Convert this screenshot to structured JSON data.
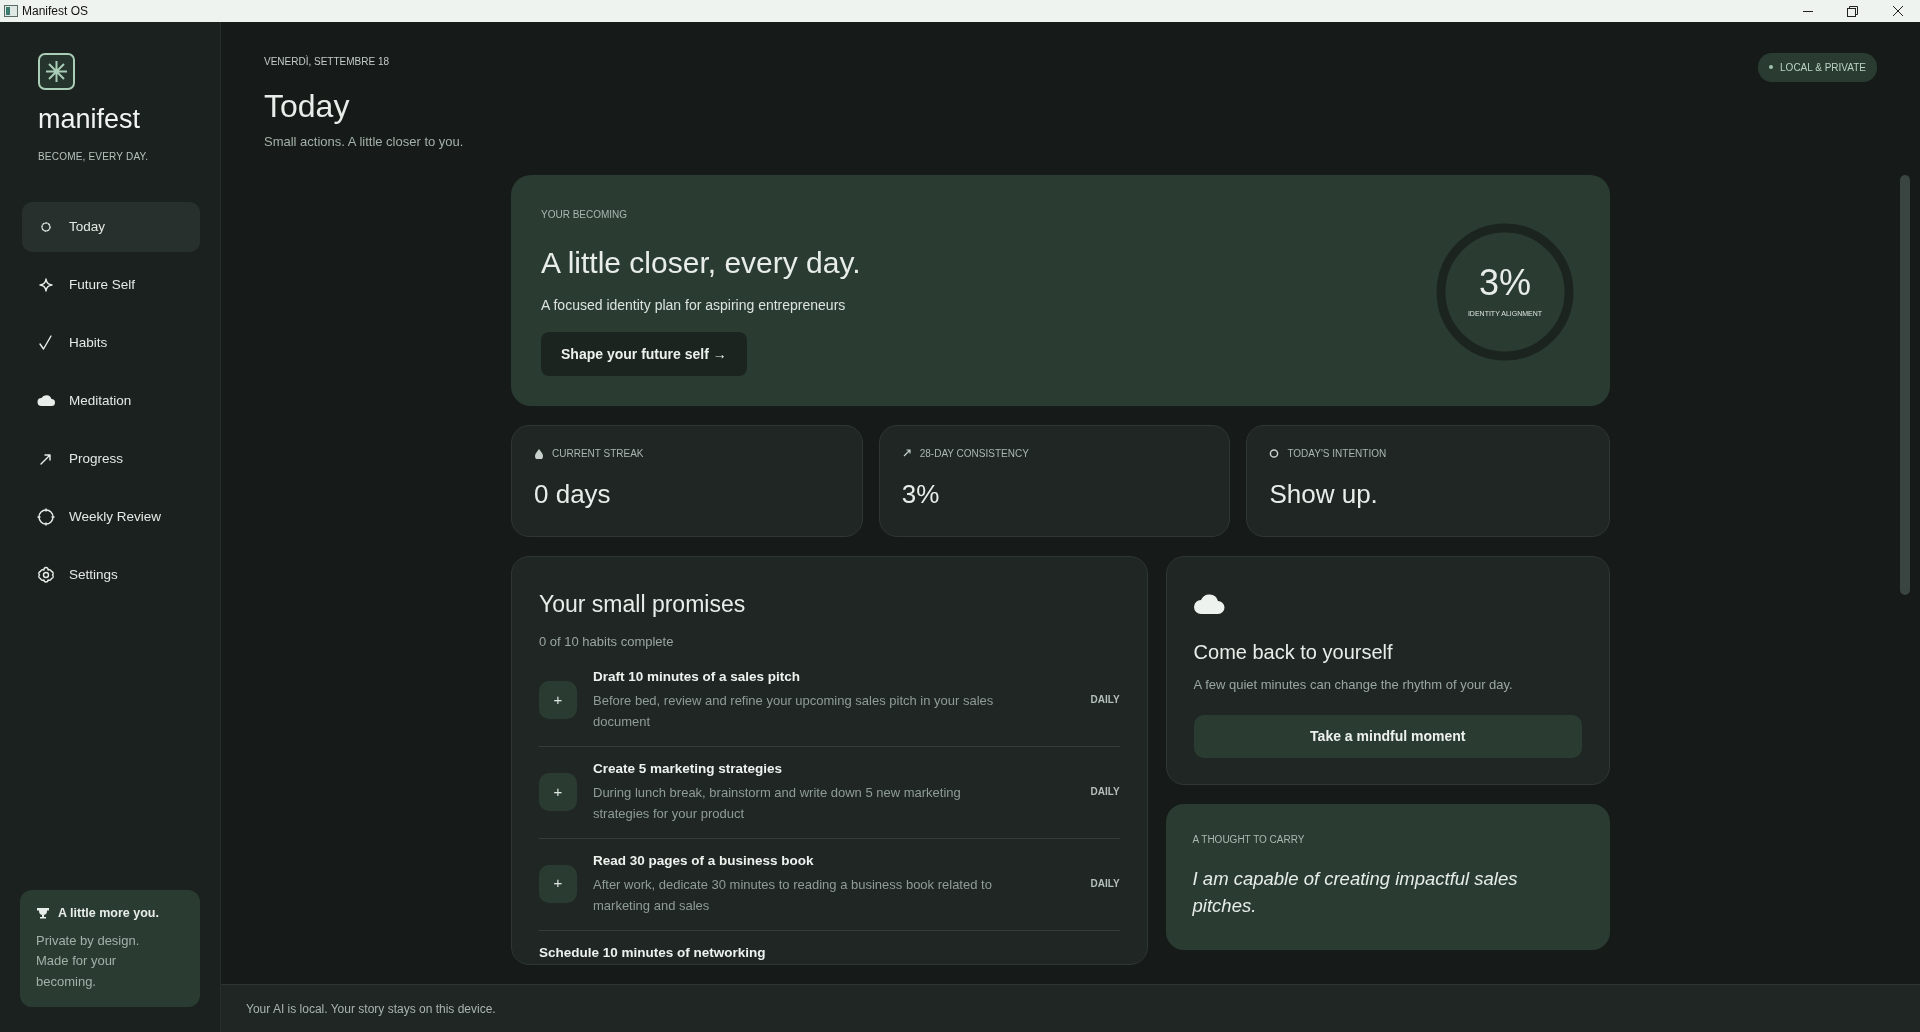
{
  "window": {
    "title": "Manifest OS"
  },
  "sidebar": {
    "brand": "manifest",
    "tagline": "BECOME, EVERY DAY.",
    "items": [
      {
        "label": "Today",
        "selected": true
      },
      {
        "label": "Future Self",
        "selected": false
      },
      {
        "label": "Habits",
        "selected": false
      },
      {
        "label": "Meditation",
        "selected": false
      },
      {
        "label": "Progress",
        "selected": false
      },
      {
        "label": "Weekly Review",
        "selected": false
      },
      {
        "label": "Settings",
        "selected": false
      }
    ],
    "note": {
      "title": "A little more you.",
      "text": "Private by design. Made for your becoming."
    }
  },
  "header": {
    "date": "VENERDÌ, SETTEMBRE 18",
    "title": "Today",
    "subtitle": "Small actions. A little closer to you.",
    "badge": "LOCAL & PRIVATE"
  },
  "hero": {
    "eyebrow": "YOUR BECOMING",
    "title": "A little closer, every day.",
    "subtitle": "A focused identity plan for aspiring entrepreneurs",
    "button": "Shape your future self →",
    "ring": {
      "value": "3%",
      "label": "IDENTITY ALIGNMENT"
    }
  },
  "stats": [
    {
      "label": "CURRENT STREAK",
      "value": "0 days"
    },
    {
      "label": "28-DAY CONSISTENCY",
      "value": "3%"
    },
    {
      "label": "TODAY'S INTENTION",
      "value": "Show up."
    }
  ],
  "promises": {
    "title": "Your small promises",
    "count": "0 of 10 habits complete",
    "habits": [
      {
        "title": "Draft 10 minutes of a sales pitch",
        "description": "Before bed, review and refine your upcoming sales pitch in your sales document",
        "frequency": "DAILY",
        "action": "+",
        "checked": false
      },
      {
        "title": "Create 5 marketing strategies",
        "description": "During lunch break, brainstorm and write down 5 new marketing strategies for your product",
        "frequency": "DAILY",
        "action": "+",
        "checked": false
      },
      {
        "title": "Read 30 pages of a business book",
        "description": "After work, dedicate 30 minutes to reading a business book related to marketing and sales",
        "frequency": "DAILY",
        "action": "+",
        "checked": false
      },
      {
        "title": "Schedule 10 minutes of networking"
      }
    ]
  },
  "meditation": {
    "title": "Come back to yourself",
    "text": "A few quiet minutes can change the rhythm of your day.",
    "button": "Take a mindful moment"
  },
  "thought": {
    "eyebrow": "A THOUGHT TO CARRY",
    "quote": "I am capable of creating impactful sales pitches."
  },
  "status_bar": {
    "text": "Your AI is local. Your story stays on this device."
  }
}
